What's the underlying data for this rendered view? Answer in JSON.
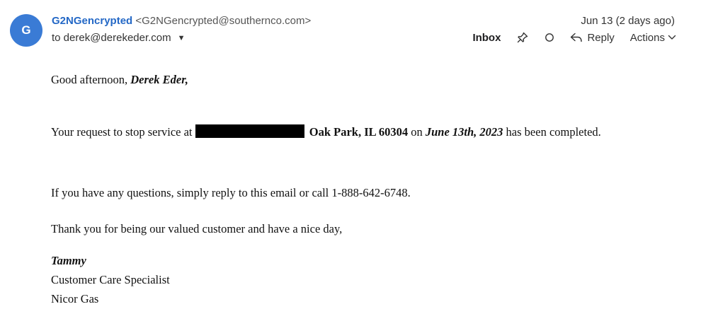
{
  "avatar": {
    "letter": "G",
    "color": "#3a7bd5"
  },
  "header": {
    "sender_name": "G2NGencrypted",
    "sender_email": "<G2NGencrypted@southernco.com>",
    "to_line": "to derek@derekeder.com",
    "date": "Jun 13 (2 days ago)",
    "toolbar": {
      "inbox_label": "Inbox",
      "reply_label": "Reply",
      "actions_label": "Actions"
    }
  },
  "message": {
    "greeting_prefix": "Good afternoon, ",
    "greeting_name": "Derek Eder,",
    "para1_a": "Your request to stop service at",
    "para1_address": "Oak Park, IL 60304",
    "para1_b": " on ",
    "para1_date": "June 13th, 2023",
    "para1_c": " has been completed.",
    "para2": "If you have any questions, simply reply to this email or call 1-888-642-6748.",
    "para3": "Thank you for being our valued customer and have a nice day,",
    "signature": {
      "name": "Tammy",
      "title": "Customer Care Specialist",
      "company": "Nicor Gas"
    }
  },
  "colors": {
    "sender_link": "#2468c6",
    "redaction": "#000000"
  },
  "icons": [
    "pin-icon",
    "circle-icon",
    "reply-icon",
    "chevron-down-icon",
    "caret-down-icon"
  ]
}
